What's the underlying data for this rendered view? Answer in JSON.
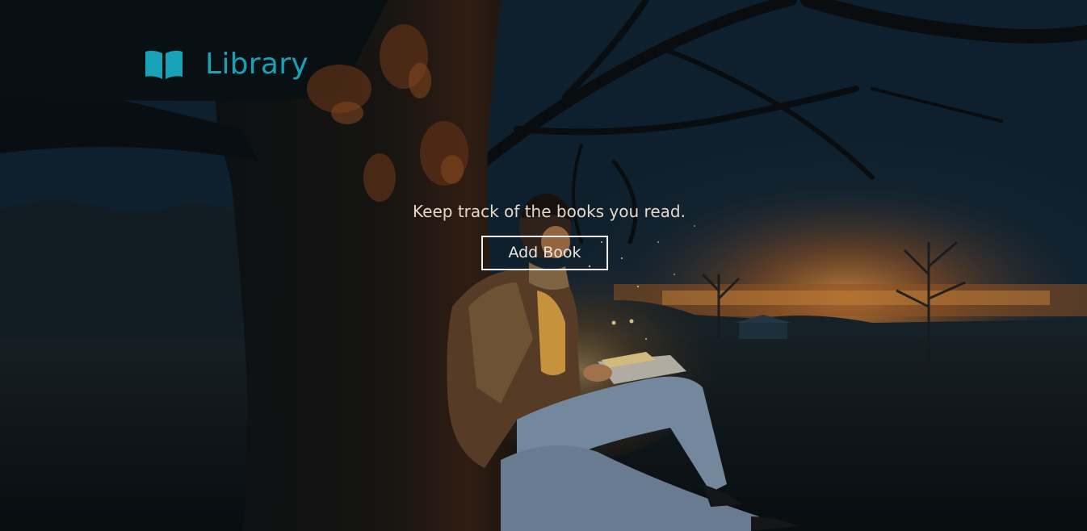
{
  "brand": {
    "icon": "open-book-icon",
    "title": "Library",
    "color": "#17a2b8"
  },
  "hero": {
    "tagline": "Keep track of the books you read.",
    "add_book_label": "Add Book"
  },
  "colors": {
    "accent": "#17a2b8",
    "text_light": "#e6d8c8",
    "button_border": "#f1efee"
  }
}
